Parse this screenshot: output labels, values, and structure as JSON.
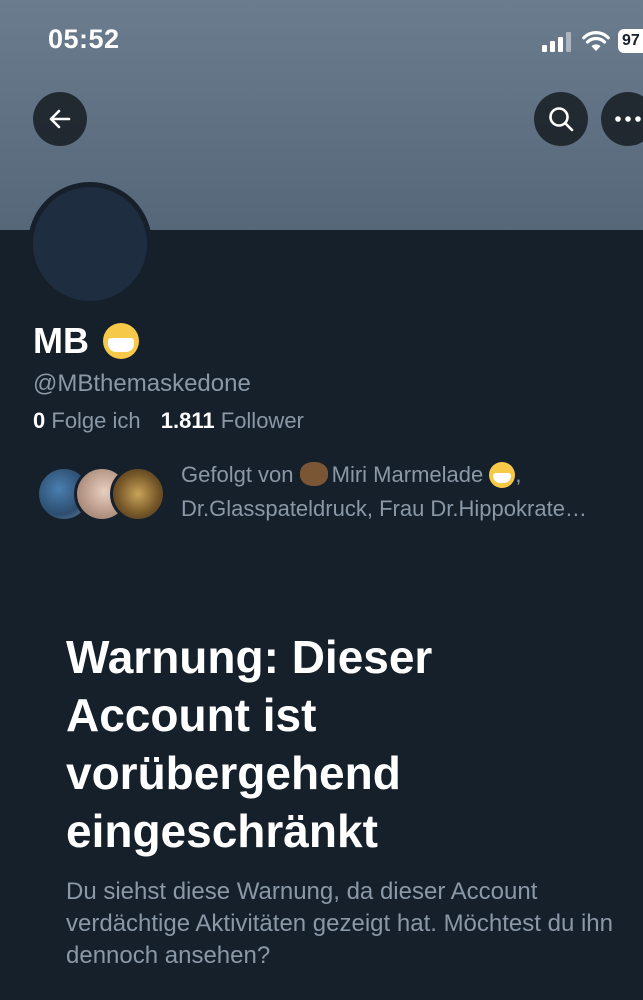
{
  "status_bar": {
    "time": "05:52",
    "battery": "97"
  },
  "header": {
    "back_icon": "arrow-left-icon",
    "search_icon": "search-icon",
    "more_icon": "more-horizontal-icon"
  },
  "profile": {
    "display_name": "MB",
    "name_emoji": "face-with-medical-mask",
    "handle": "@MBthemaskedone",
    "following_count": "0",
    "following_label": "Folge ich",
    "followers_count": "1.811",
    "followers_label": "Follower"
  },
  "followed_by": {
    "prefix": "Gefolgt von",
    "first_name": "Miri Marmelade",
    "line2": "Dr.Glasspateldruck, Frau Dr.Hippokrate…"
  },
  "warning": {
    "title": "Warnung: Dieser Account ist vorübergehend eingeschränkt",
    "text": "Du siehst diese Warnung, da dieser Account verdächtige Aktivitäten gezeigt hat. Möchtest du ihn dennoch ansehen?"
  },
  "colors": {
    "background": "#15202b",
    "banner": "#5f7083",
    "secondary_text": "#8b98a5"
  }
}
